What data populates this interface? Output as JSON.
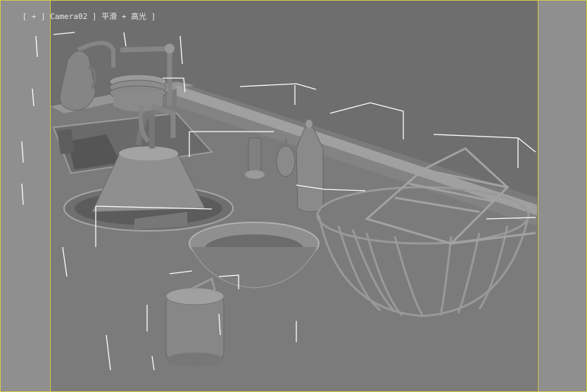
{
  "viewport": {
    "label_open": "[ ",
    "label_plus": "+",
    "label_sep1": " ] ",
    "label_camera": "Camera02",
    "label_sep2": " ] ",
    "label_shading": "平滑 + 高光",
    "label_close": " ]"
  },
  "colors": {
    "frame": "#d8c84a",
    "background": "#6e6e6e",
    "margin": "#8f8f8f",
    "label": "#e8e8e8",
    "object_gray": "#8a8a8a",
    "selection_bracket": "#ffffff"
  },
  "scene_objects": [
    "pitcher",
    "faucet-left",
    "plate-stack",
    "sink",
    "kettle",
    "faucet-right",
    "pepper-mill",
    "honey-dipper",
    "bottle",
    "woven-bowl",
    "wire-basket-large",
    "wire-basket-small",
    "canister"
  ]
}
